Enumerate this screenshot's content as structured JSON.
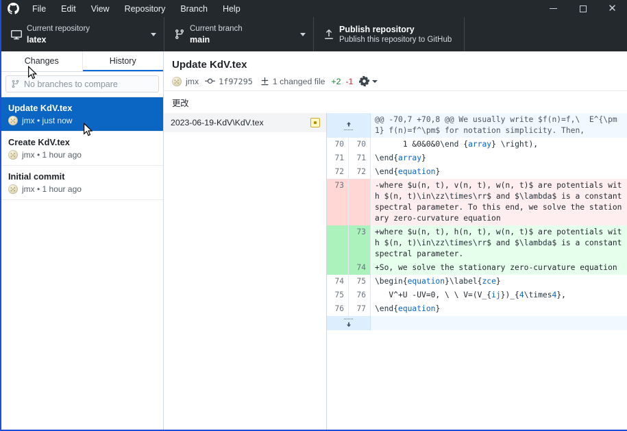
{
  "window": {
    "app_icon": "github-logo-icon",
    "minimize": "minimize-icon",
    "maximize": "maximize-icon",
    "close": "close-icon"
  },
  "menu": {
    "items": [
      {
        "label": "File"
      },
      {
        "label": "Edit"
      },
      {
        "label": "View"
      },
      {
        "label": "Repository"
      },
      {
        "label": "Branch"
      },
      {
        "label": "Help"
      }
    ]
  },
  "toolbar": {
    "repository": {
      "label": "Current repository",
      "value": "latex",
      "icon": "repo-desktop-icon"
    },
    "branch": {
      "label": "Current branch",
      "value": "main",
      "icon": "git-branch-icon"
    },
    "publish": {
      "title": "Publish repository",
      "subtitle": "Publish this repository to GitHub",
      "icon": "upload-arrow-icon"
    }
  },
  "sidebar": {
    "tabs": [
      {
        "label": "Changes",
        "active": false
      },
      {
        "label": "History",
        "active": true
      }
    ],
    "compare": {
      "placeholder": "No branches to compare",
      "icon": "git-branch-icon"
    },
    "commits": [
      {
        "title": "Update KdV.tex",
        "author": "jmx",
        "time": "just now",
        "meta": "jmx • just now",
        "selected": true
      },
      {
        "title": "Create KdV.tex",
        "author": "jmx",
        "time": "1 hour ago",
        "meta": "jmx • 1 hour ago",
        "selected": false
      },
      {
        "title": "Initial commit",
        "author": "jmx",
        "time": "1 hour ago",
        "meta": "jmx • 1 hour ago",
        "selected": false
      }
    ]
  },
  "commit_detail": {
    "title": "Update KdV.tex",
    "author": "jmx",
    "sha": "1f97295",
    "changed_files": "1 changed file",
    "additions": "+2",
    "deletions": "-1",
    "gear": "gear-icon",
    "section_label": "更改"
  },
  "files": [
    {
      "path": "2023-06-19-KdV\\KdV.tex",
      "status": "modified"
    }
  ],
  "diff": {
    "expand_up": "expand-up-icon",
    "expand_down": "expand-down-icon",
    "rows": [
      {
        "type": "hunk",
        "old": "",
        "new": "",
        "text": "@@ -70,7 +70,8 @@ We usually write $f(n)=f,\\  E^{\\pm1} f(n)=f^\\pm$ for notation simplicity. Then,"
      },
      {
        "type": "context",
        "old": "70",
        "new": "70",
        "text": "      1 &0&0&0\\end {array} \\right),"
      },
      {
        "type": "context",
        "old": "71",
        "new": "71",
        "text": "\\end{array}"
      },
      {
        "type": "context",
        "old": "72",
        "new": "72",
        "text": "\\end{equation}"
      },
      {
        "type": "del",
        "old": "73",
        "new": "",
        "text": "-where $u(n, t), v(n, t), w(n, t)$ are potentials with $(n, t)\\in\\zz\\times\\rr$ and $\\lambda$ is a constant spectral parameter. To this end, we solve the stationary zero-curvature equation"
      },
      {
        "type": "add",
        "old": "",
        "new": "73",
        "text": "+where $u(n, t), h(n, t), w(n, t)$ are potentials with $(n, t)\\in\\zz\\times\\rr$ and $\\lambda$ is a constant spectral parameter."
      },
      {
        "type": "add",
        "old": "",
        "new": "74",
        "text": "+So, we solve the stationary zero-curvature equation"
      },
      {
        "type": "context",
        "old": "74",
        "new": "75",
        "text": "\\begin{equation}\\label{zce}"
      },
      {
        "type": "context",
        "old": "75",
        "new": "76",
        "text": "   V^+U -UV=0, \\ \\ V=(V_{ij})_{4\\times4},"
      },
      {
        "type": "context",
        "old": "76",
        "new": "77",
        "text": "\\end{equation}"
      }
    ]
  }
}
